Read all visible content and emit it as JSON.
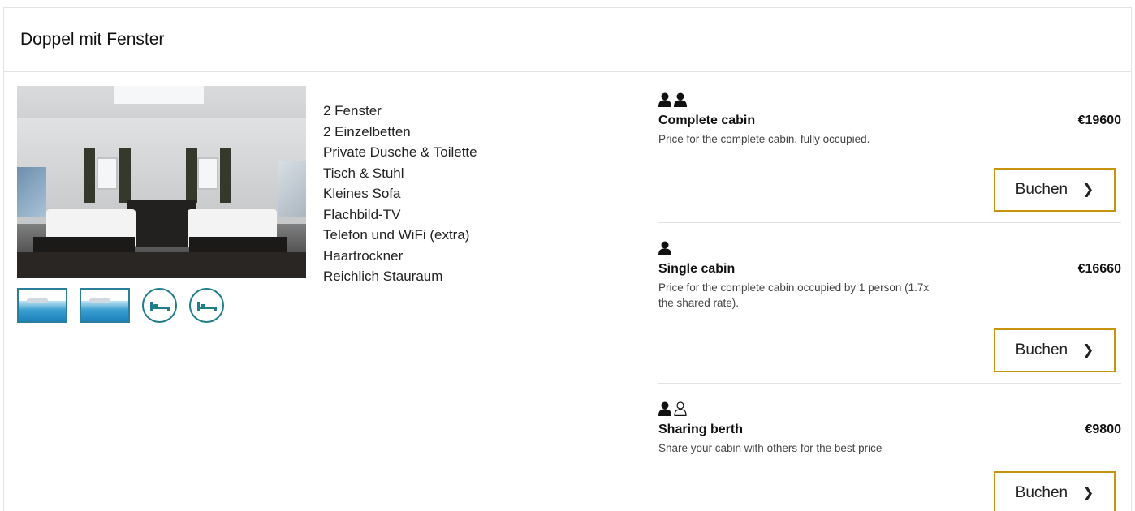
{
  "card": {
    "title": "Doppel mit Fenster"
  },
  "features": [
    "2 Fenster",
    "2 Einzelbetten",
    "Private Dusche & Toilette",
    "Tisch & Stuhl",
    "Kleines Sofa",
    "Flachbild-TV",
    "Telefon und WiFi (extra)",
    "Haartrockner",
    "Reichlich Stauraum"
  ],
  "thumbnails": [
    {
      "type": "image",
      "icon": "sea-photo-thumb"
    },
    {
      "type": "image",
      "icon": "sea-photo-thumb"
    },
    {
      "type": "icon",
      "icon": "bed-icon"
    },
    {
      "type": "icon",
      "icon": "bed-icon"
    }
  ],
  "options": [
    {
      "occupancy": [
        "filled",
        "filled"
      ],
      "name": "Complete cabin",
      "price": "€19600",
      "description": "Price for the complete cabin, fully occupied.",
      "button_label": "Buchen",
      "button_icon": "chevron-right-icon"
    },
    {
      "occupancy": [
        "filled"
      ],
      "name": "Single cabin",
      "price": "€16660",
      "description": "Price for the complete cabin occupied by 1 person (1.7x the shared rate).",
      "button_label": "Buchen",
      "button_icon": "chevron-right-icon"
    },
    {
      "occupancy": [
        "filled",
        "outline"
      ],
      "name": "Sharing berth",
      "price": "€9800",
      "description": "Share your cabin with others for the best price",
      "button_label": "Buchen",
      "button_icon": "chevron-right-icon"
    }
  ],
  "colors": {
    "button_border": "#c8940f",
    "thumb_border": "#2c7f9b",
    "icon_teal": "#1f7e8a",
    "divider": "#e3e3e3"
  }
}
